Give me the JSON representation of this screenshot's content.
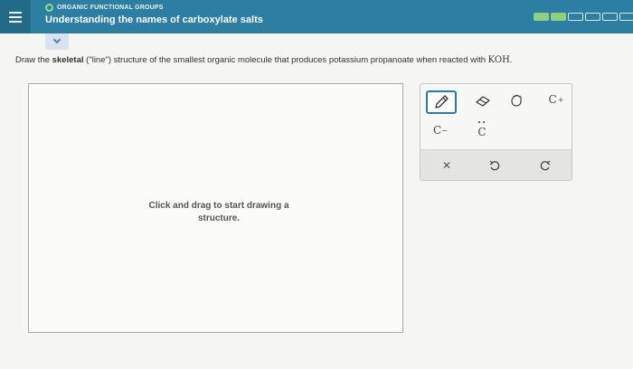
{
  "header": {
    "topic": "ORGANIC FUNCTIONAL GROUPS",
    "title": "Understanding the names of carboxylate salts",
    "progress_total": 6,
    "progress_filled": 2,
    "colors": {
      "bar": "#2c7fa2",
      "progress_filled": "#8ed07c",
      "topic_dot": "#8fe07a"
    }
  },
  "question": {
    "prefix": "Draw the ",
    "bold": "skeletal",
    "middle": " (\"line\") structure of the smallest organic molecule that produces potassium propanoate when reacted with ",
    "reagent": "KOH",
    "suffix": "."
  },
  "canvas": {
    "hint": "Click and drag to start drawing a structure."
  },
  "toolbox": {
    "carbon_plus": {
      "symbol": "C",
      "charge": "+"
    },
    "carbon_minus": {
      "symbol": "C",
      "charge": "−"
    },
    "carbon_radical": {
      "symbol": "C",
      "dots": "••"
    },
    "clear_symbol": "✕",
    "icons": [
      "pencil-icon",
      "eraser-icon",
      "hand-icon",
      "clear-icon",
      "undo-icon",
      "redo-icon"
    ]
  }
}
